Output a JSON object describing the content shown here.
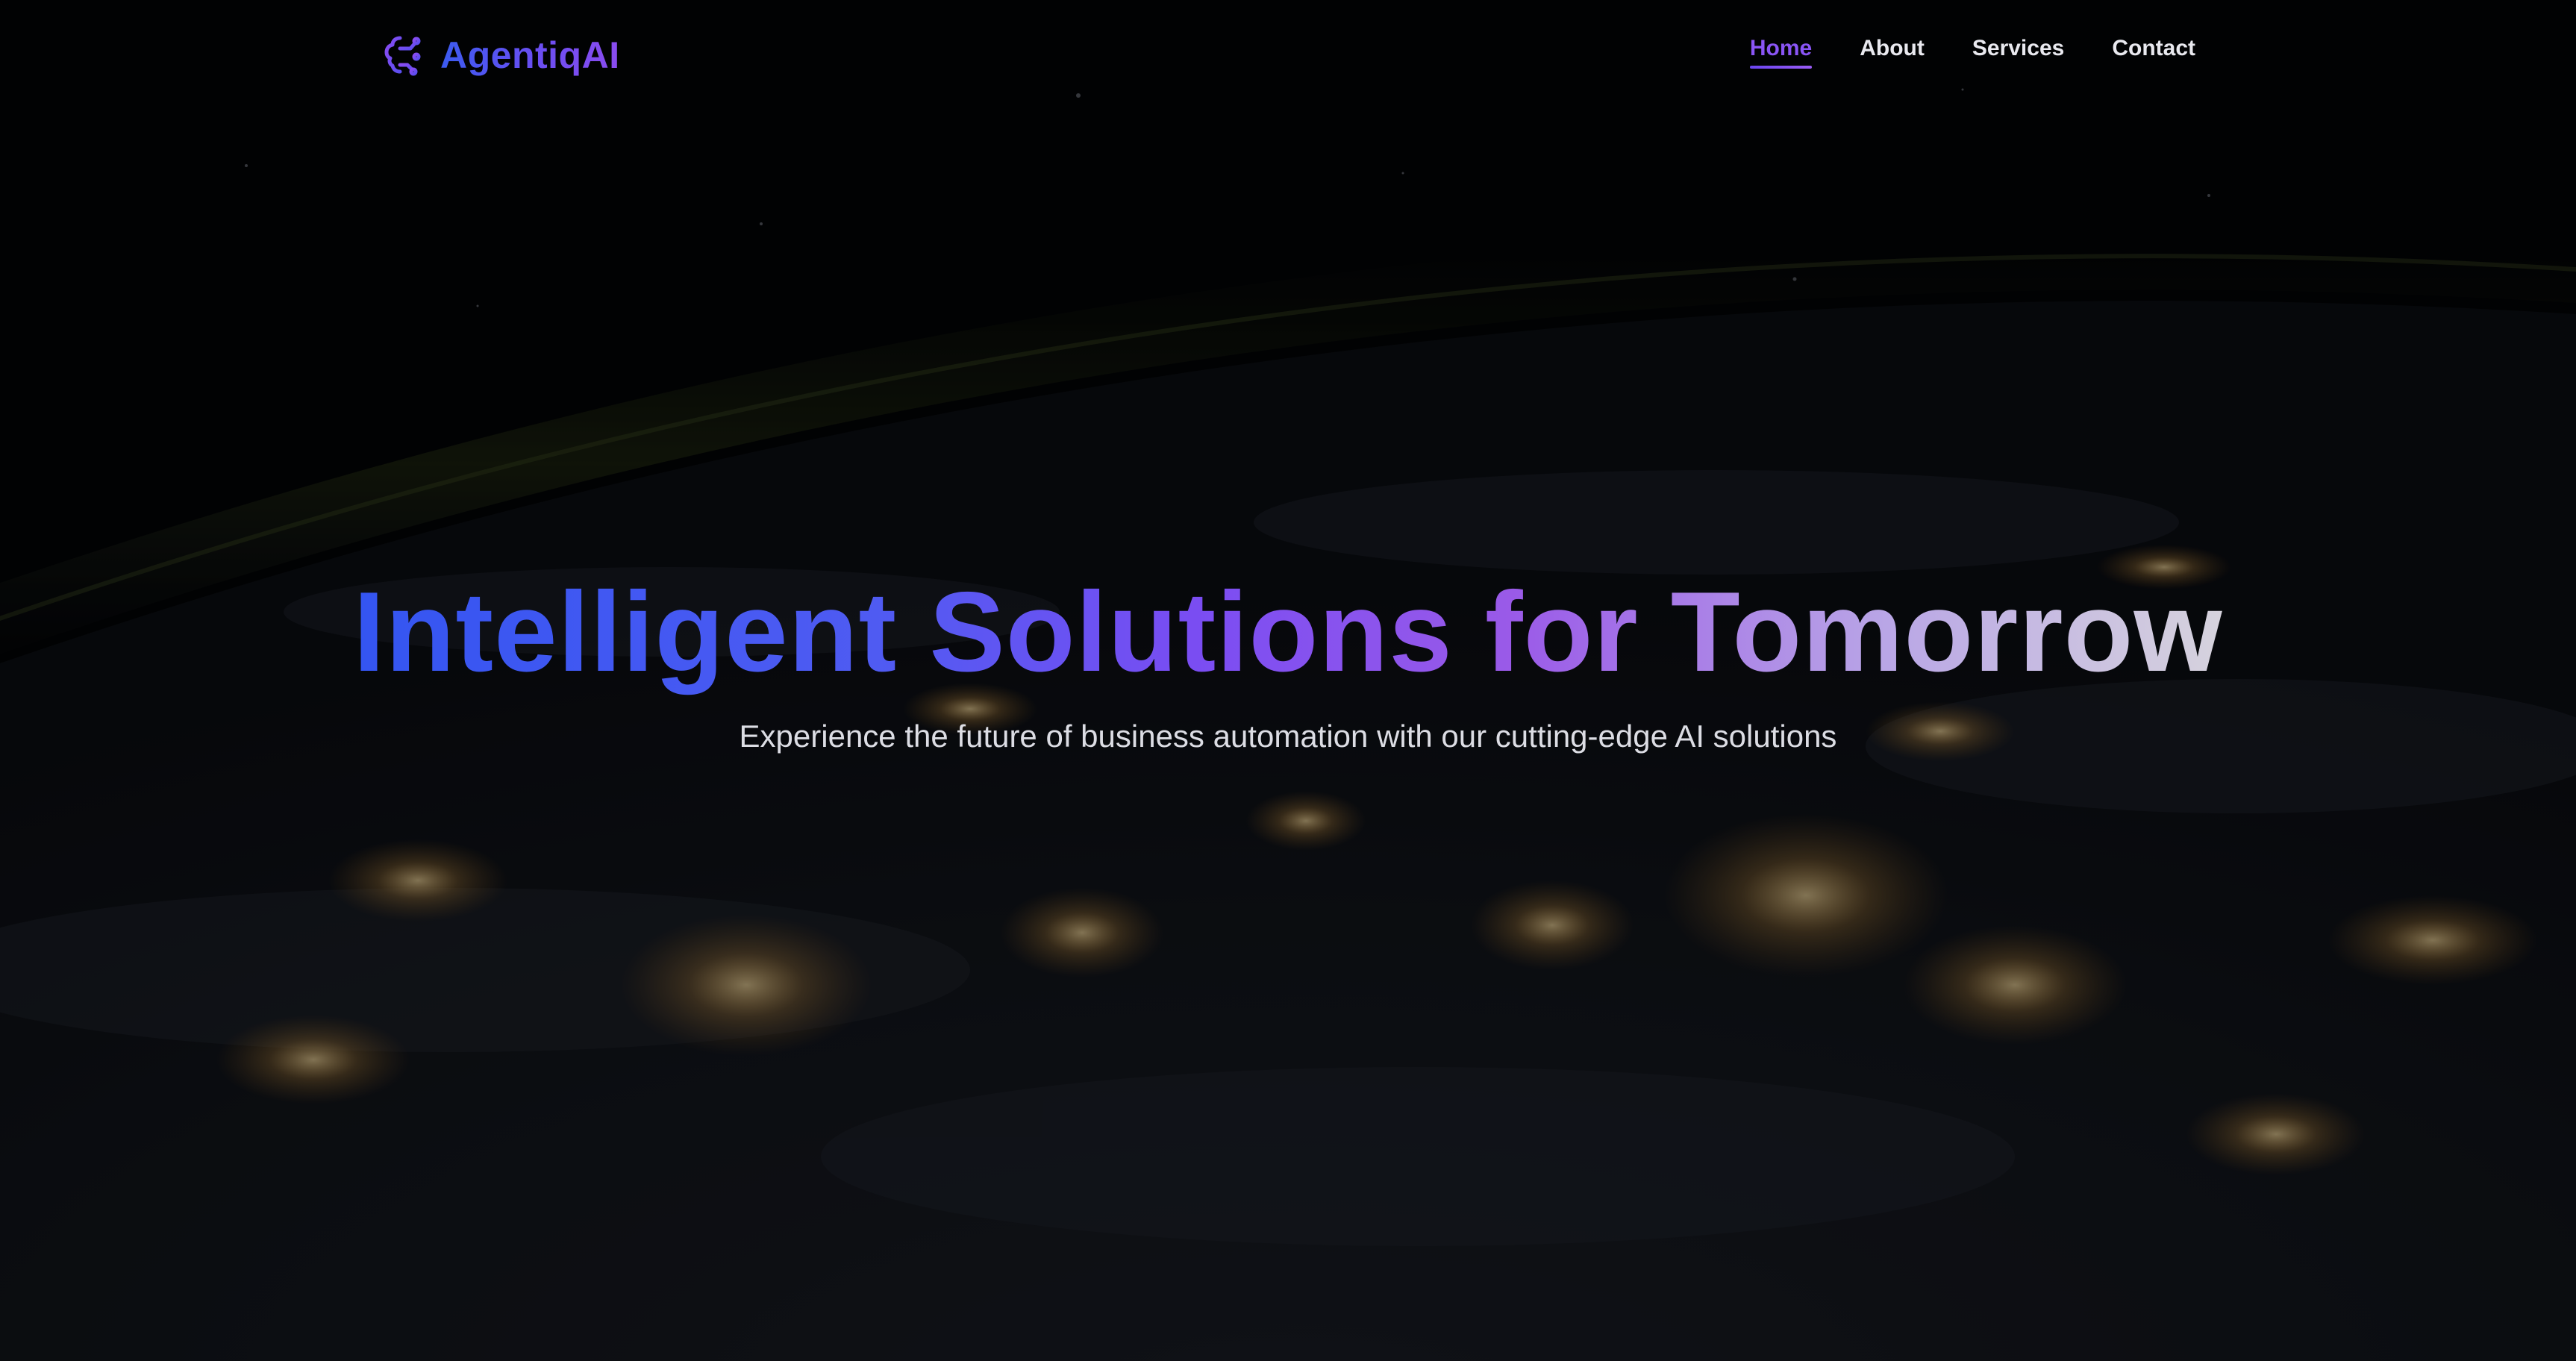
{
  "brand": {
    "name": "AgentiqAI",
    "icon": "brain-icon"
  },
  "nav": {
    "items": [
      {
        "label": "Home",
        "active": true
      },
      {
        "label": "About",
        "active": false
      },
      {
        "label": "Services",
        "active": false
      },
      {
        "label": "Contact",
        "active": false
      }
    ]
  },
  "hero": {
    "title": "Intelligent Solutions for Tomorrow",
    "subtitle": "Experience the future of business automation with our cutting-edge AI solutions"
  },
  "colors": {
    "accent": "#8a55f5",
    "brand_start": "#3b5bf0",
    "brand_end": "#8b4cf0",
    "background": "#040507"
  }
}
